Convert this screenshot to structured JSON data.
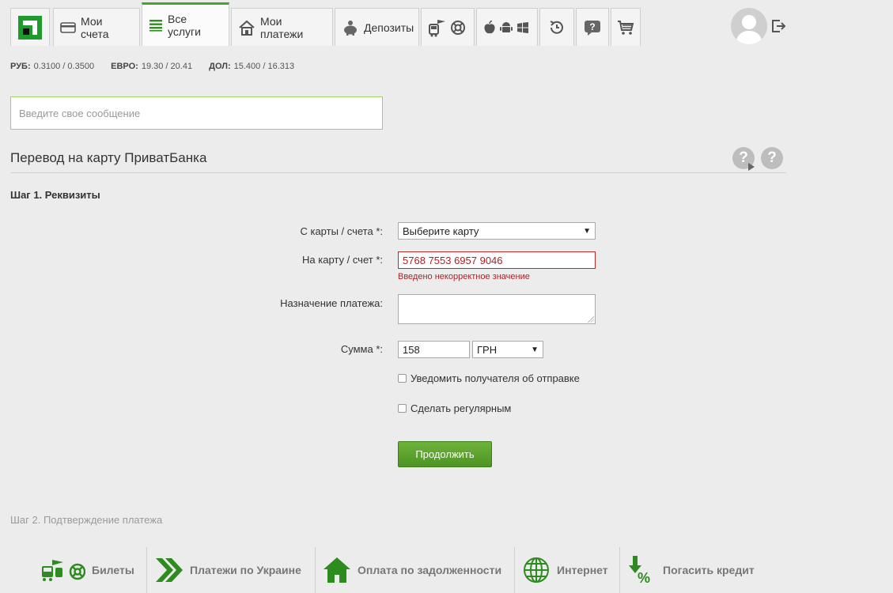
{
  "nav": {
    "tabs": [
      {
        "label": "Мои счета",
        "icon": "card-icon"
      },
      {
        "label": "Все услуги",
        "icon": "list-icon",
        "active": true
      },
      {
        "label": "Мои платежи",
        "icon": "house-icon"
      },
      {
        "label": "Депозиты",
        "icon": "piggy-bank-icon"
      }
    ]
  },
  "rates": [
    {
      "code": "РУБ:",
      "value": "0.3100 / 0.3500"
    },
    {
      "code": "ЕВРО:",
      "value": "19.30 / 20.41"
    },
    {
      "code": "ДОЛ:",
      "value": "15.400 / 16.313"
    }
  ],
  "message": {
    "placeholder": "Введите свое сообщение"
  },
  "section": {
    "title": "Перевод на карту ПриватБанка",
    "step1": "Шаг 1. Реквизиты",
    "step2": "Шаг 2. Подтверждение платежа"
  },
  "form": {
    "from_label": "С карты / счета *:",
    "from_value": "Выберите карту",
    "to_label": "На карту / счет *:",
    "to_value": "5768 7553 6957 9046",
    "to_error": "Введено некорректное значение",
    "purpose_label": "Назначение платежа:",
    "amount_label": "Сумма *:",
    "amount_value": "158",
    "currency_value": "ГРН",
    "notify_label": "Уведомить получателя об отправке",
    "regular_label": "Сделать регулярным",
    "continue_label": "Продолжить"
  },
  "bottom": [
    {
      "label": "Билеты",
      "icon": "tickets-icon"
    },
    {
      "label": "Платежи по Украине",
      "icon": "double-chevron-icon"
    },
    {
      "label": "Оплата по задолженности",
      "icon": "home-green-icon"
    },
    {
      "label": "Интернет",
      "icon": "globe-icon"
    },
    {
      "label": "Погасить кредит",
      "icon": "credit-percent-icon"
    }
  ],
  "colors": {
    "accent": "#48a32f",
    "brand": "#1e9b2c",
    "error": "#c0282d"
  }
}
